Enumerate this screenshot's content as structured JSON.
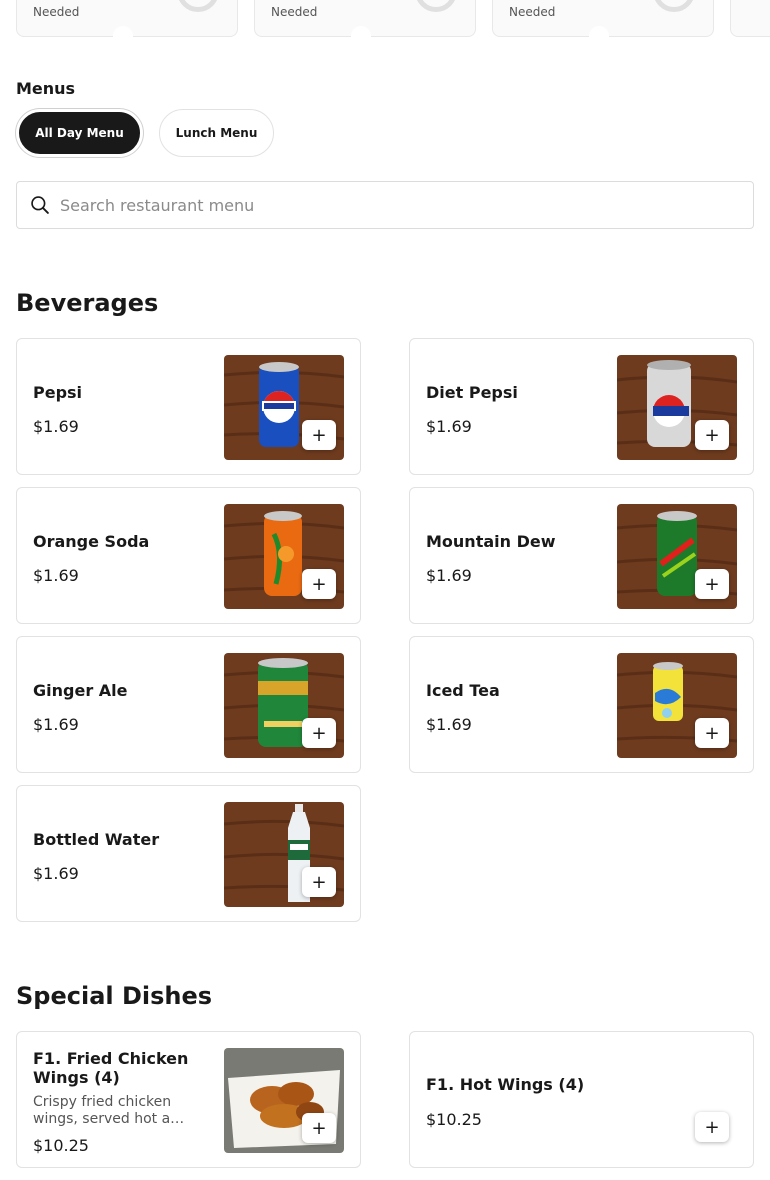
{
  "offers": [
    {
      "label": "Needed"
    },
    {
      "label": "Needed"
    },
    {
      "label": "Needed"
    }
  ],
  "menus": {
    "title": "Menus",
    "items": [
      {
        "label": "All Day Menu",
        "active": true
      },
      {
        "label": "Lunch Menu",
        "active": false
      }
    ]
  },
  "search": {
    "placeholder": "Search restaurant menu"
  },
  "sections": [
    {
      "title": "Beverages",
      "items": [
        {
          "name": "Pepsi",
          "price": "$1.69",
          "image": "blue-can",
          "add": "+"
        },
        {
          "name": "Diet Pepsi",
          "price": "$1.69",
          "image": "silver-can",
          "add": "+"
        },
        {
          "name": "Orange Soda",
          "price": "$1.69",
          "image": "orange-can",
          "add": "+"
        },
        {
          "name": "Mountain Dew",
          "price": "$1.69",
          "image": "green-can",
          "add": "+"
        },
        {
          "name": "Ginger Ale",
          "price": "$1.69",
          "image": "green-gold-can",
          "add": "+"
        },
        {
          "name": "Iced Tea",
          "price": "$1.69",
          "image": "yellow-blue-can",
          "add": "+"
        },
        {
          "name": "Bottled Water",
          "price": "$1.69",
          "image": "water-bottle",
          "add": "+"
        }
      ]
    },
    {
      "title": "Special Dishes",
      "items": [
        {
          "name": "F1. Fried Chicken Wings (4)",
          "description": "Crispy fried chicken wings, served hot a…",
          "price": "$10.25",
          "image": "fried-wings",
          "add": "+"
        },
        {
          "name": "F1. Hot Wings (4)",
          "price": "$10.25",
          "add": "+"
        }
      ]
    }
  ],
  "colors": {
    "accent": "#191919",
    "border": "#e2e2e2",
    "wood": "#6b3a1f"
  }
}
